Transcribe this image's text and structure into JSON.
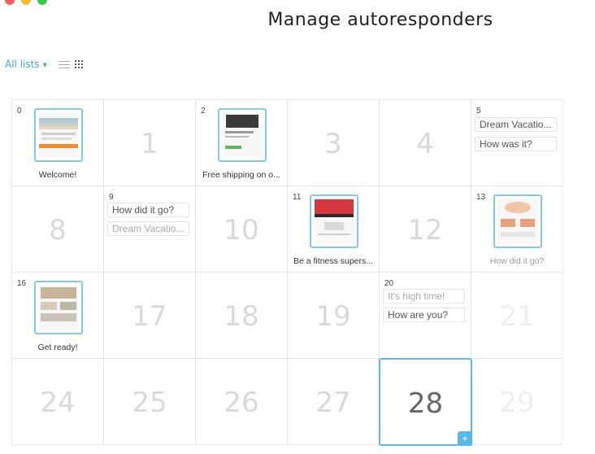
{
  "window": {
    "title": "Manage autoresponders"
  },
  "toolbar": {
    "lists_label": "All lists",
    "list_view_icon": "list-icon",
    "grid_view_icon": "grid-icon"
  },
  "calendar": {
    "cells": {
      "c0": {
        "day": "0",
        "label": "Welcome!"
      },
      "c1": {
        "big": "1"
      },
      "c2": {
        "day": "2",
        "label": "Free shipping on o..."
      },
      "c3": {
        "big": "3"
      },
      "c4": {
        "big": "4"
      },
      "c5": {
        "day": "5",
        "chip1": "Dream Vacatio...",
        "chip2": "How was it?"
      },
      "c8": {
        "big": "8"
      },
      "c9": {
        "day": "9",
        "chip1": "How did it go?",
        "chip2": "Dream Vacatio..."
      },
      "c10": {
        "big": "10"
      },
      "c11": {
        "day": "11",
        "label": "Be a fitness supers..."
      },
      "c12": {
        "big": "12"
      },
      "c13": {
        "day": "13",
        "label": "How did it go?"
      },
      "c16": {
        "day": "16",
        "label": "Get ready!"
      },
      "c17": {
        "big": "17"
      },
      "c18": {
        "big": "18"
      },
      "c19": {
        "big": "19"
      },
      "c20": {
        "day": "20",
        "chip1": "It's high time!",
        "chip2": "How are you?"
      },
      "c21": {
        "big": "21"
      },
      "c24": {
        "big": "24"
      },
      "c25": {
        "big": "25"
      },
      "c26": {
        "big": "26"
      },
      "c27": {
        "big": "27"
      },
      "c28": {
        "big": "28",
        "add": "+"
      },
      "c29": {
        "big": "29"
      }
    }
  },
  "colors": {
    "accent": "#5ab8e6",
    "link": "#3fa9dd"
  }
}
